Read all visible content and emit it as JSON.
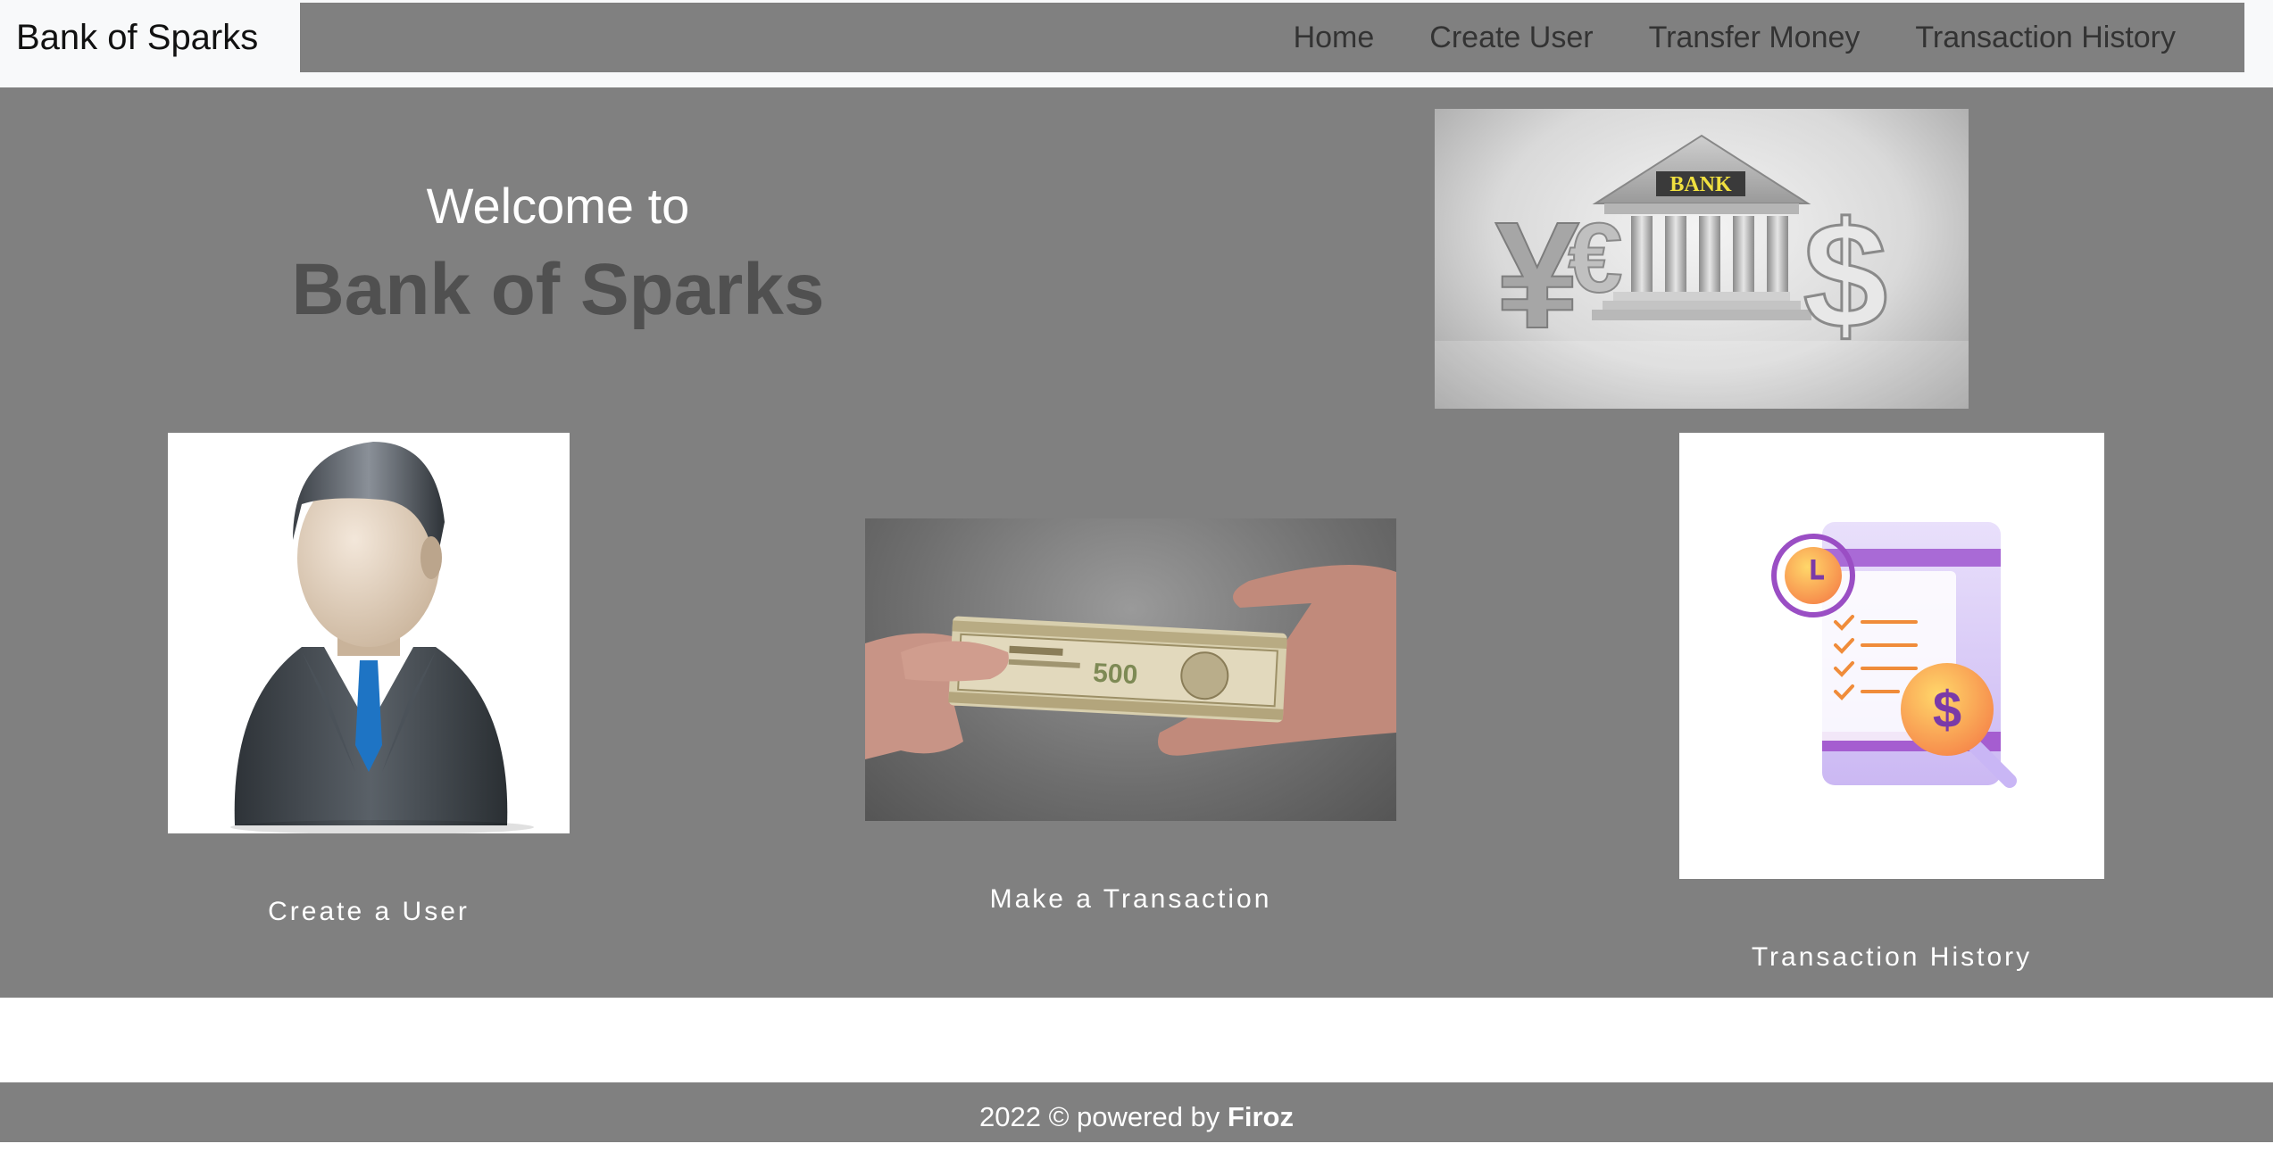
{
  "navbar": {
    "brand": "Bank of Sparks",
    "links": [
      "Home",
      "Create User",
      "Transfer Money",
      "Transaction History"
    ]
  },
  "hero": {
    "welcome": "Welcome to",
    "title": "Bank of Sparks",
    "bank_sign": "BANK"
  },
  "cards": {
    "create_user": "Create a User",
    "make_transaction": "Make a Transaction",
    "transaction_history": "Transaction History"
  },
  "footer": {
    "prefix": "2022 © powered by ",
    "author": "Firoz"
  },
  "colors": {
    "page_bg": "#808080",
    "navbar_bg": "#f8f9fa",
    "title_dark": "#505050"
  }
}
